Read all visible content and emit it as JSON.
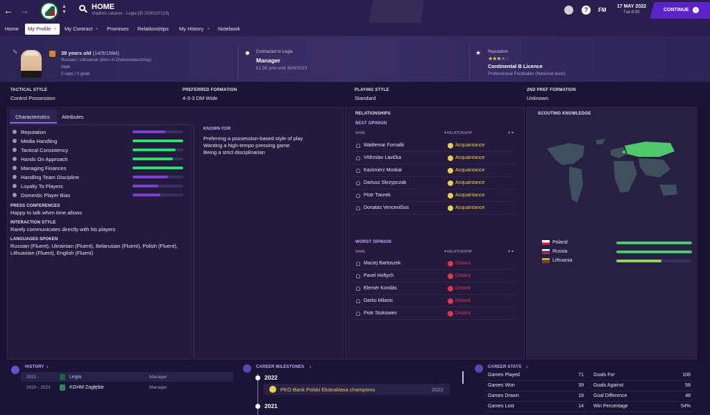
{
  "header": {
    "title": "HOME",
    "subtitle": "Vladimir Latunov - Legia (ID 2000107123)",
    "date": "17 MAY 2022",
    "time": "Tue 8:00",
    "fm_label": "FM",
    "continue_label": "CONTINUE",
    "accent": "#5c22c9"
  },
  "nav": {
    "home": "Home",
    "my_profile": "My Profile",
    "my_contract": "My Contract",
    "promises": "Promises",
    "relationships": "Relationships",
    "my_history": "My History",
    "notebook": "Notebook"
  },
  "profile": {
    "age": "38 years old",
    "dob": "(14/5/1984)",
    "nationality": "Russian / Lithuanian (Born in Zheleznodorozhny)",
    "gender": "Male",
    "caps": "0 caps / 0 goals",
    "contract_label": "Contracted to Legia",
    "role": "Manager",
    "wage": "£1.5K p/w until 30/6/2023",
    "reputation_label": "Reputation",
    "stars": 3.5,
    "licence": "Continental B Licence",
    "playing_background": "Professional Footballer (National level)"
  },
  "summary": [
    {
      "label": "TACTICAL STYLE",
      "value": "Control Possession"
    },
    {
      "label": "PREFERRED FORMATION",
      "value": "4-3-3 DM Wide"
    },
    {
      "label": "PLAYING STYLE",
      "value": "Standard"
    },
    {
      "label": "2ND PREF FORMATION",
      "value": "Unknown"
    }
  ],
  "tabs": {
    "characteristics": "Characteristics",
    "attributes": "Attributes"
  },
  "characteristics": [
    {
      "name": "Reputation",
      "level": 0.65,
      "color": "#7b3fd6"
    },
    {
      "name": "Media Handling",
      "level": 1.0,
      "color": "#27e36a"
    },
    {
      "name": "Tactical Consistency",
      "level": 0.85,
      "color": "#27e36a"
    },
    {
      "name": "Hands On Approach",
      "level": 0.8,
      "color": "#27e36a"
    },
    {
      "name": "Managing Finances",
      "level": 1.0,
      "color": "#27e36a"
    },
    {
      "name": "Handling Team Discipline",
      "level": 0.7,
      "color": "#7b3fd6"
    },
    {
      "name": "Loyalty To Players",
      "level": 0.5,
      "color": "#7b3fd6"
    },
    {
      "name": "Domestic Player Bias",
      "level": 0.55,
      "color": "#7b3fd6"
    }
  ],
  "known_for": {
    "label": "KNOWN FOR",
    "items": [
      "Preferring a possession-based style of play",
      "Wanting a high-tempo pressing game",
      "Being a strict disciplinarian"
    ]
  },
  "press": {
    "label": "PRESS CONFERENCES",
    "value": "Happy to talk when time allows"
  },
  "interaction": {
    "label": "INTERACTION STYLE",
    "value": "Rarely communicates directly with his players"
  },
  "languages": {
    "label": "LANGUAGES SPOKEN",
    "line1": "Russian (Fluent), Ukrainian (Fluent), Belarusian (Fluent), Polish (Fluent),",
    "line2": "Lithuanian (Fluent), English (Fluent)"
  },
  "relationships": {
    "title": "RELATIONSHIPS",
    "best_label": "BEST OPINION",
    "worst_label": "WORST OPINION",
    "col_name": "NAME",
    "col_rel": "RELATIONSHIP",
    "best": [
      {
        "name": "Waldemar Fornalik",
        "rel": "Acquaintance"
      },
      {
        "name": "Vítězslav Lavička",
        "rel": "Acquaintance"
      },
      {
        "name": "Kazimierz Moskal",
        "rel": "Acquaintance"
      },
      {
        "name": "Dariusz Skrzypczak",
        "rel": "Acquaintance"
      },
      {
        "name": "Piotr Tworek",
        "rel": "Acquaintance"
      },
      {
        "name": "Donatas Vencevičius",
        "rel": "Acquaintance"
      }
    ],
    "worst": [
      {
        "name": "Maciej Bartoszek",
        "rel": "Distant"
      },
      {
        "name": "Pavel Hoftych",
        "rel": "Distant"
      },
      {
        "name": "Elemér Kondás",
        "rel": "Distant"
      },
      {
        "name": "Darko Milanic",
        "rel": "Distant"
      },
      {
        "name": "Piotr Stokowiec",
        "rel": "Distant"
      }
    ],
    "good_color": "#e8d24a",
    "bad_color": "#e0384a"
  },
  "scouting": {
    "title": "SCOUTING KNOWLEDGE",
    "countries": [
      {
        "name": "Poland",
        "level": 1.0
      },
      {
        "name": "Russia",
        "level": 1.0
      },
      {
        "name": "Lithuania",
        "level": 0.6
      }
    ]
  },
  "history": {
    "title": "HISTORY",
    "rows": [
      {
        "years": "2021 -",
        "club": "Legia",
        "role": "Manager"
      },
      {
        "years": "2020 - 2021",
        "club": "KGHM Zagłębie",
        "role": "Manager"
      }
    ]
  },
  "milestones": {
    "title": "CAREER MILESTONES",
    "year1": "2022",
    "item": "PKO Bank Polski Ekstraklasa champions",
    "item_year": "2022",
    "year2": "2021"
  },
  "stats": {
    "title": "CAREER STATS",
    "left": [
      {
        "label": "Games Played",
        "value": "71"
      },
      {
        "label": "Games Won",
        "value": "39"
      },
      {
        "label": "Games Drawn",
        "value": "18"
      },
      {
        "label": "Games Lost",
        "value": "14"
      }
    ],
    "right": [
      {
        "label": "Goals For",
        "value": "106"
      },
      {
        "label": "Goals Against",
        "value": "58"
      },
      {
        "label": "Goal Difference",
        "value": "48"
      },
      {
        "label": "Win Percentage",
        "value": "54%"
      }
    ]
  }
}
